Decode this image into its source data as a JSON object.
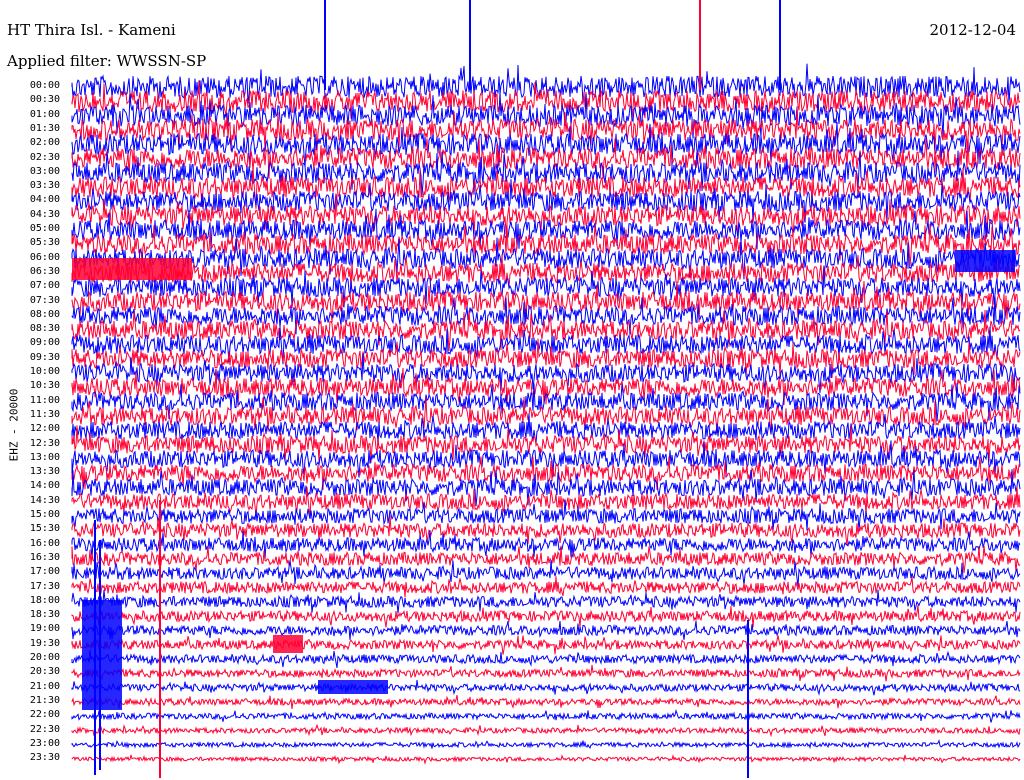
{
  "header": {
    "station": "HT Thira Isl. - Kameni",
    "date": "2012-12-04",
    "filter": "Applied filter: WWSSN-SP"
  },
  "chart_data": {
    "type": "line",
    "title": "HT Thira Isl. - Kameni",
    "ylabel": "EHZ - 20000",
    "rows": [
      "00:00",
      "00:30",
      "01:00",
      "01:30",
      "02:00",
      "02:30",
      "03:00",
      "03:30",
      "04:00",
      "04:30",
      "05:00",
      "05:30",
      "06:00",
      "06:30",
      "07:00",
      "07:30",
      "08:00",
      "08:30",
      "09:00",
      "09:30",
      "10:00",
      "10:30",
      "11:00",
      "11:30",
      "12:00",
      "12:30",
      "13:00",
      "13:30",
      "14:00",
      "14:30",
      "15:00",
      "15:30",
      "16:00",
      "16:30",
      "17:00",
      "17:30",
      "18:00",
      "18:30",
      "19:00",
      "19:30",
      "20:00",
      "20:30",
      "21:00",
      "21:30",
      "22:00",
      "22:30",
      "23:00",
      "23:30"
    ],
    "colors": [
      "#0000ff",
      "#ff0033"
    ]
  }
}
